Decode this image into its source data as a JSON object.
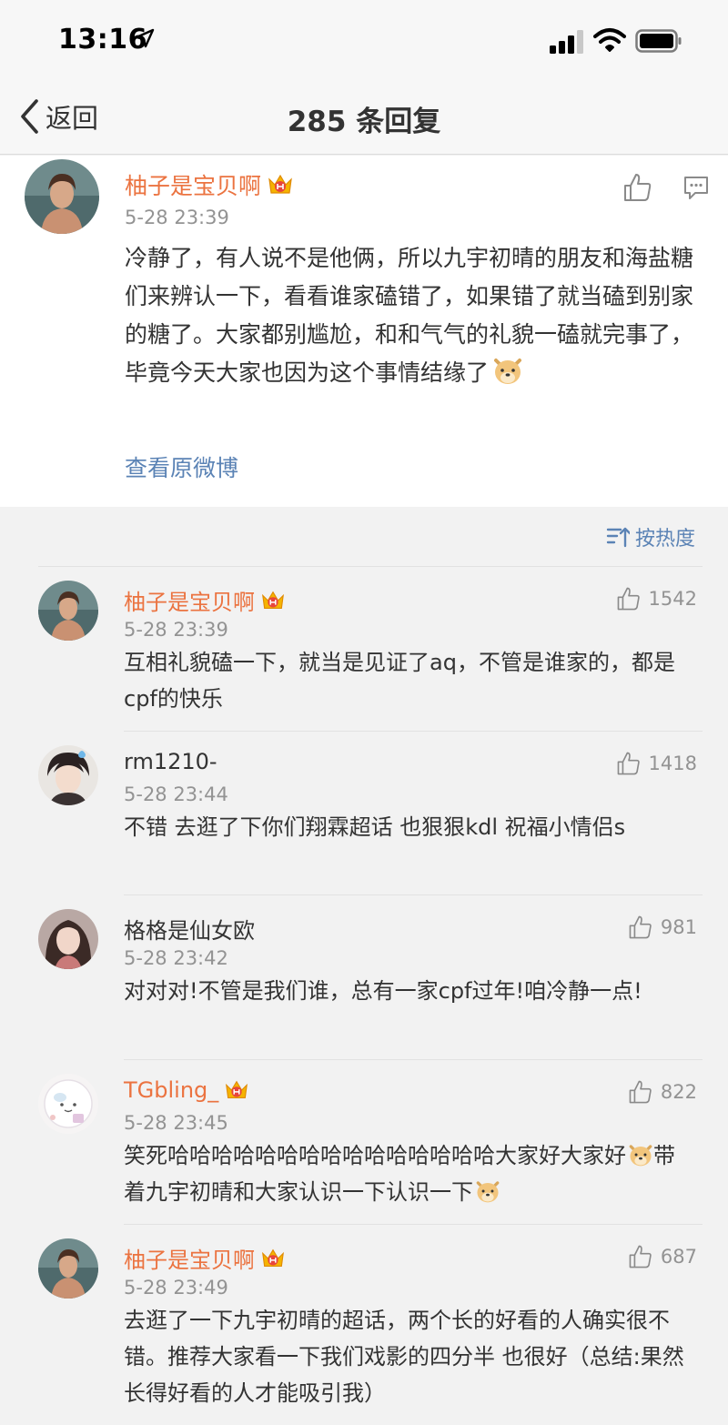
{
  "status_bar": {
    "time": "13:16"
  },
  "nav": {
    "back_label": "返回",
    "title": "285 条回复"
  },
  "post": {
    "author": "柚子是宝贝啊",
    "time": "5-28 23:39",
    "text": "冷静了，有人说不是他俩，所以九宇初晴的朋友和海盐糖们来辨认一下，看看谁家磕错了，如果错了就当磕到别家的糖了。大家都别尴尬，和和气气的礼貌一磕就完事了，毕竟今天大家也因为这个事情结缘了",
    "view_original": "查看原微博"
  },
  "sort": {
    "label": "按热度"
  },
  "comments": [
    {
      "author": "柚子是宝贝啊",
      "vip": true,
      "time": "5-28 23:39",
      "likes": "1542",
      "text": "互相礼貌磕一下，就当是见证了aq，不管是谁家的，都是cpf的快乐"
    },
    {
      "author": "rm1210-",
      "vip": false,
      "time": "5-28 23:44",
      "likes": "1418",
      "text": "不错 去逛了下你们翔霖超话 也狠狠kdl 祝福小情侣s"
    },
    {
      "author": "格格是仙女欧",
      "vip": false,
      "time": "5-28 23:42",
      "likes": "981",
      "text": "对对对!不管是我们谁，总有一家cpf过年!咱冷静一点!"
    },
    {
      "author": "TGbling_",
      "vip": true,
      "time": "5-28 23:45",
      "likes": "822",
      "text_a": "笑死哈哈哈哈哈哈哈哈哈哈哈哈哈哈哈大家好大家好",
      "text_b": "带着九宇初晴和大家认识一下认识一下"
    },
    {
      "author": "柚子是宝贝啊",
      "vip": true,
      "time": "5-28 23:49",
      "likes": "687",
      "text": "去逛了一下九宇初晴的超话，两个长的好看的人确实很不错。推荐大家看一下我们戏影的四分半 也很好（总结:果然长得好看的人才能吸引我）"
    }
  ]
}
